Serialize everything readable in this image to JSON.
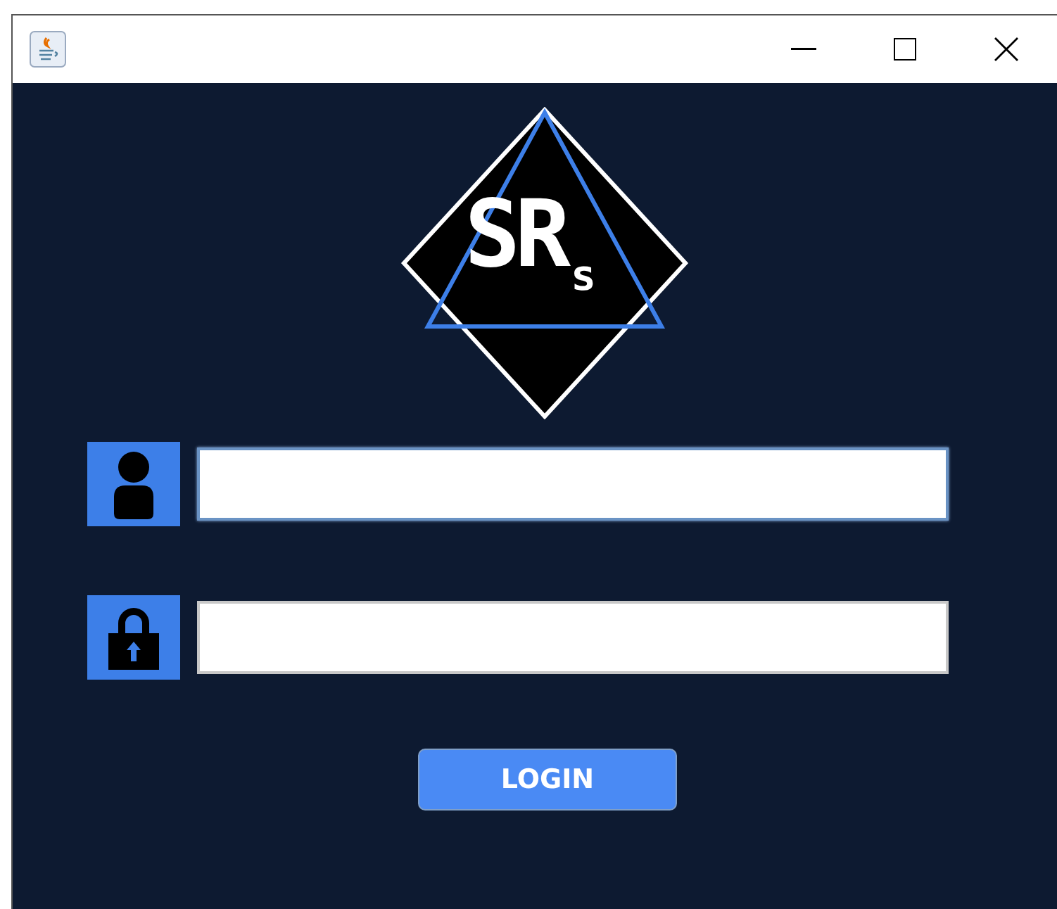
{
  "logo": {
    "text": "SR",
    "subscript": "s"
  },
  "fields": [
    {
      "kind": "user",
      "focused": true
    },
    {
      "kind": "password",
      "focused": false
    }
  ],
  "button": {
    "label": "LOGIN"
  }
}
